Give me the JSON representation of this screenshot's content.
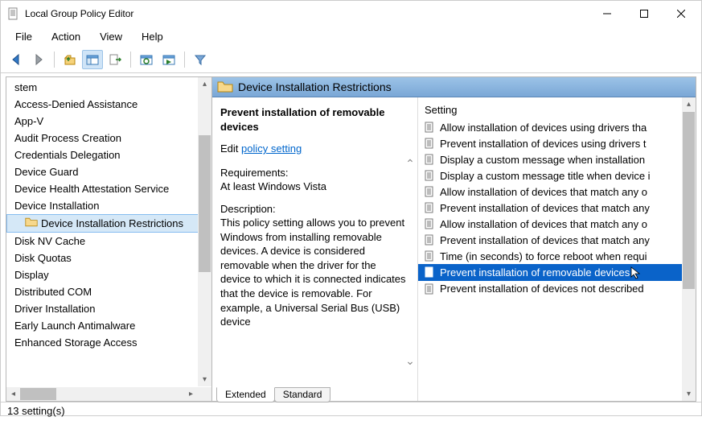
{
  "window": {
    "title": "Local Group Policy Editor"
  },
  "menu": [
    "File",
    "Action",
    "View",
    "Help"
  ],
  "tree": {
    "items": [
      "stem",
      "Access-Denied Assistance",
      "App-V",
      "Audit Process Creation",
      "Credentials Delegation",
      "Device Guard",
      "Device Health Attestation Service",
      "Device Installation",
      "Device Installation Restrictions",
      "Disk NV Cache",
      "Disk Quotas",
      "Display",
      "Distributed COM",
      "Driver Installation",
      "Early Launch Antimalware",
      "Enhanced Storage Access"
    ],
    "selectedIndex": 8
  },
  "header": {
    "title": "Device Installation Restrictions"
  },
  "detail": {
    "policy_title": "Prevent installation of removable devices",
    "edit_prefix": "Edit",
    "edit_link": "policy setting",
    "req_label": "Requirements:",
    "req_value": "At least Windows Vista",
    "desc_label": "Description:",
    "desc_text": "This policy setting allows you to prevent Windows from installing removable devices. A device is considered removable when the driver for the device to which it is connected indicates that the device is removable. For example, a Universal Serial Bus (USB) device"
  },
  "settings": {
    "header": "Setting",
    "items": [
      "Allow installation of devices using drivers tha",
      "Prevent installation of devices using drivers t",
      "Display a custom message when installation ",
      "Display a custom message title when device i",
      "Allow installation of devices that match any o",
      "Prevent installation of devices that match any",
      "Allow installation of devices that match any o",
      "Prevent installation of devices that match any",
      "Time (in seconds) to force reboot when requi",
      "Prevent installation of removable devices",
      "Prevent installation of devices not described "
    ],
    "selectedIndex": 9
  },
  "tabs": {
    "items": [
      "Extended",
      "Standard"
    ],
    "activeIndex": 0
  },
  "status": {
    "text": "13 setting(s)"
  }
}
